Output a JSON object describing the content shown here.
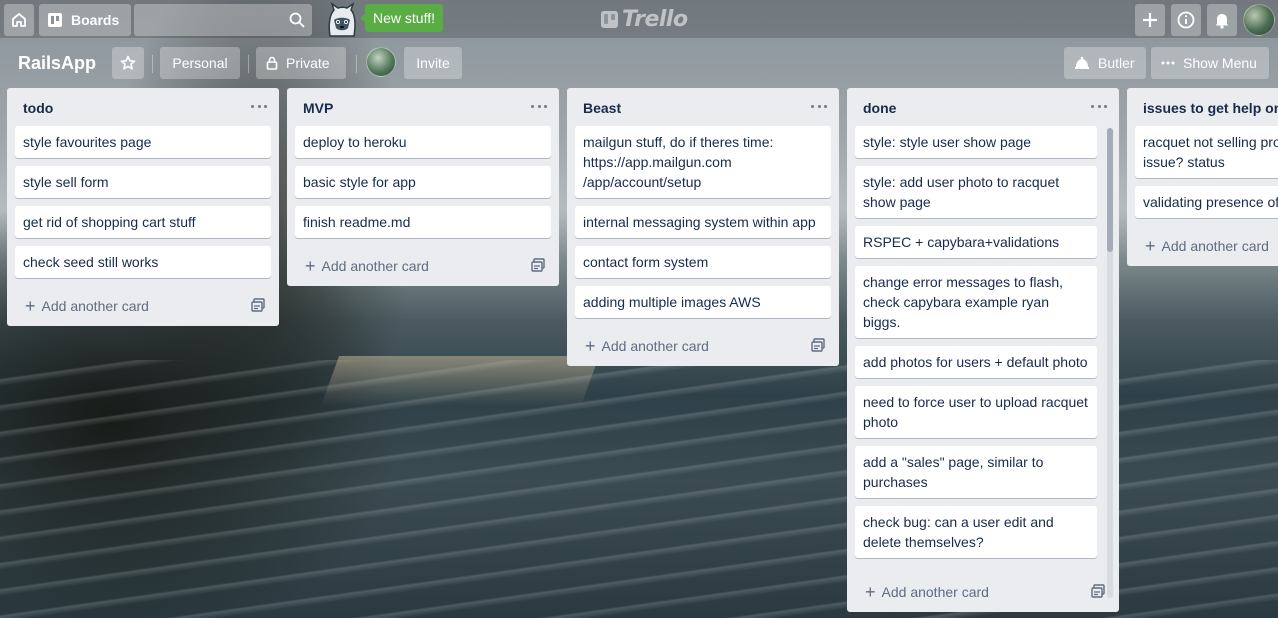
{
  "header": {
    "boards_label": "Boards",
    "search_value": "",
    "new_stuff_label": "New stuff!",
    "logo_text": "Trello"
  },
  "board": {
    "title": "RailsApp",
    "team_label": "Personal",
    "visibility_label": "Private",
    "invite_label": "Invite",
    "butler_label": "Butler",
    "show_menu_label": "Show Menu"
  },
  "lists": [
    {
      "title": "todo",
      "cards": [
        "style favourites page",
        "style sell form",
        "get rid of shopping cart stuff",
        "check seed still works"
      ],
      "add_label": "Add another card"
    },
    {
      "title": "MVP",
      "cards": [
        "deploy to heroku",
        "basic style for app",
        "finish readme.md"
      ],
      "add_label": "Add another card"
    },
    {
      "title": "Beast",
      "cards": [
        "mailgun stuff, do if theres time: https://app.mailgun.com /app/account/setup",
        "internal messaging system within app",
        "contact form system",
        "adding multiple images AWS"
      ],
      "add_label": "Add another card"
    },
    {
      "title": "done",
      "cards": [
        "style: style user show page",
        "style: add user photo to racquet show page",
        "RSPEC + capybara+validations",
        "change error messages to flash, check capybara example ryan biggs.",
        "add photos for users + default photo",
        "need to force user to upload racquet photo",
        "add a \"sales\" page, similar to purchases",
        "check bug: can a user edit and delete themselves?"
      ],
      "add_label": "Add another card"
    },
    {
      "title": "issues to get help on",
      "cards": [
        "racquet not selling properly, webhook issue? status",
        "validating presence of attachment"
      ],
      "add_label": "Add another card"
    }
  ]
}
